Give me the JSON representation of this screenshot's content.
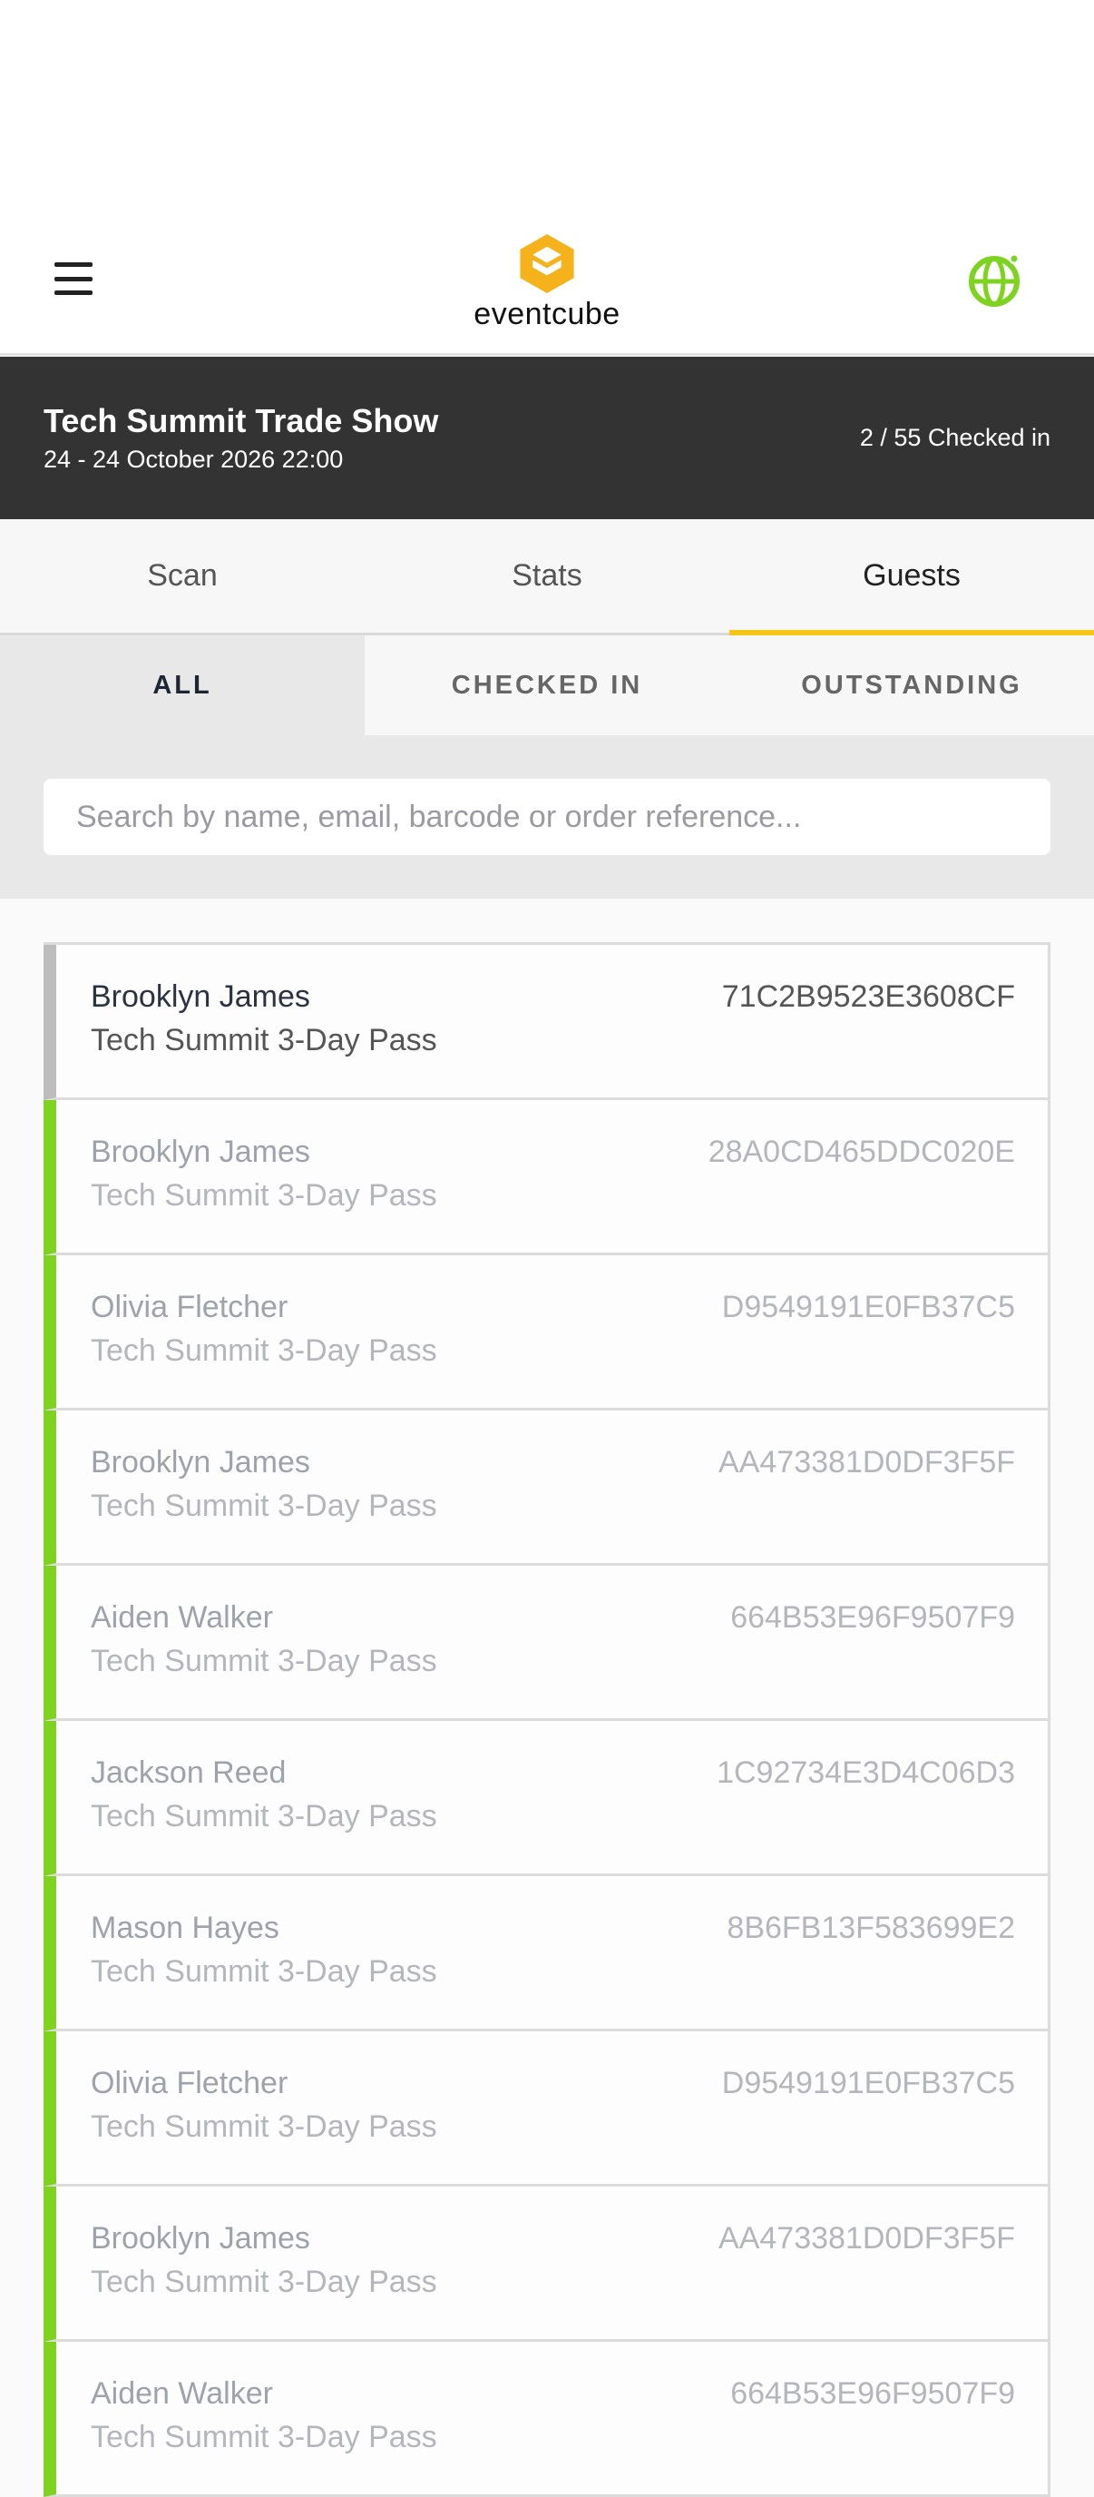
{
  "header": {
    "logo_text": "eventcube",
    "icons": {
      "menu": "hamburger-menu-icon",
      "language": "globe-icon"
    },
    "colors": {
      "logo": "#f5b21b",
      "globe": "#7ed321"
    }
  },
  "event": {
    "title": "Tech Summit Trade Show",
    "date": "24 - 24 October 2026 22:00",
    "checked_in": "2 / 55 Checked in"
  },
  "tabs": [
    {
      "label": "Scan",
      "active": false
    },
    {
      "label": "Stats",
      "active": false
    },
    {
      "label": "Guests",
      "active": true
    }
  ],
  "filters": [
    {
      "label": "ALL",
      "active": true
    },
    {
      "label": "CHECKED IN",
      "active": false
    },
    {
      "label": "OUTSTANDING",
      "active": false
    }
  ],
  "search": {
    "placeholder": "Search by name, email, barcode or order reference...",
    "value": ""
  },
  "guests": [
    {
      "name": "Brooklyn James",
      "ticket": "Tech Summit 3-Day Pass",
      "code": "71C2B9523E3608CF",
      "checked_in": false
    },
    {
      "name": "Brooklyn James",
      "ticket": "Tech Summit 3-Day Pass",
      "code": "28A0CD465DDC020E",
      "checked_in": true
    },
    {
      "name": "Olivia Fletcher",
      "ticket": "Tech Summit 3-Day Pass",
      "code": "D9549191E0FB37C5",
      "checked_in": true
    },
    {
      "name": "Brooklyn James",
      "ticket": "Tech Summit 3-Day Pass",
      "code": "AA473381D0DF3F5F",
      "checked_in": true
    },
    {
      "name": "Aiden Walker",
      "ticket": "Tech Summit 3-Day Pass",
      "code": "664B53E96F9507F9",
      "checked_in": true
    },
    {
      "name": "Jackson Reed",
      "ticket": "Tech Summit 3-Day Pass",
      "code": "1C92734E3D4C06D3",
      "checked_in": true
    },
    {
      "name": "Mason Hayes",
      "ticket": "Tech Summit 3-Day Pass",
      "code": "8B6FB13F583699E2",
      "checked_in": true
    },
    {
      "name": "Olivia Fletcher",
      "ticket": "Tech Summit 3-Day Pass",
      "code": "D9549191E0FB37C5",
      "checked_in": true
    },
    {
      "name": "Brooklyn James",
      "ticket": "Tech Summit 3-Day Pass",
      "code": "AA473381D0DF3F5F",
      "checked_in": true
    },
    {
      "name": "Aiden Walker",
      "ticket": "Tech Summit 3-Day Pass",
      "code": "664B53E96F9507F9",
      "checked_in": true
    }
  ]
}
